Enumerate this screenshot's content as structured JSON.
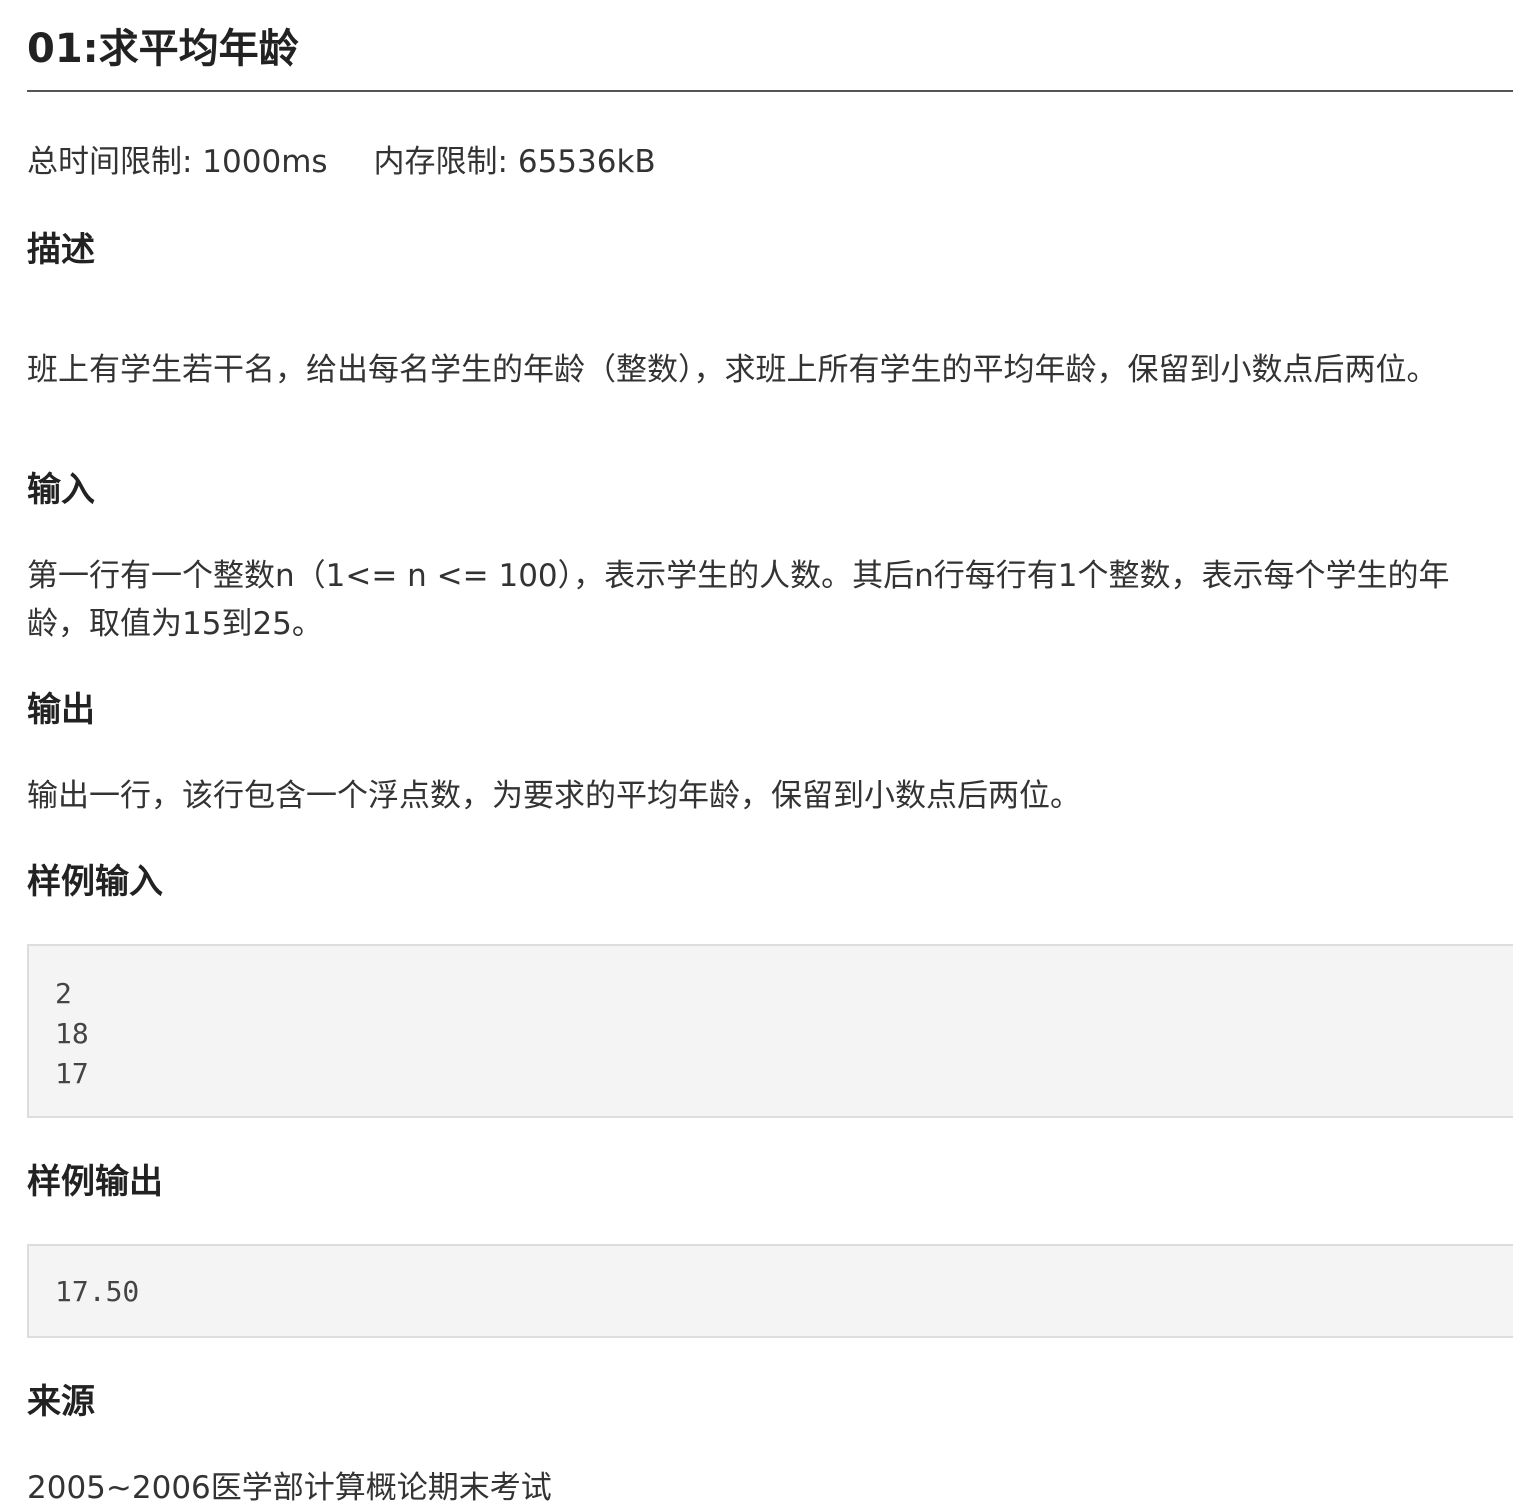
{
  "problem": {
    "title": "01:求平均年龄",
    "time_limit": "总时间限制: 1000ms",
    "memory_limit": "内存限制: 65536kB"
  },
  "sections": {
    "description": {
      "heading": "描述",
      "text": "班上有学生若干名，给出每名学生的年龄（整数），求班上所有学生的平均年龄，保留到小数点后两位。"
    },
    "input": {
      "heading": "输入",
      "text": "第一行有一个整数n（1<= n <= 100），表示学生的人数。其后n行每行有1个整数，表示每个学生的年龄，取值为15到25。"
    },
    "output": {
      "heading": "输出",
      "text": "输出一行，该行包含一个浮点数，为要求的平均年龄，保留到小数点后两位。"
    },
    "sample_input": {
      "heading": "样例输入",
      "code": "2\n18\n17"
    },
    "sample_output": {
      "heading": "样例输出",
      "code": "17.50"
    },
    "source": {
      "heading": "来源",
      "text": "2005~2006医学部计算概论期末考试"
    }
  }
}
